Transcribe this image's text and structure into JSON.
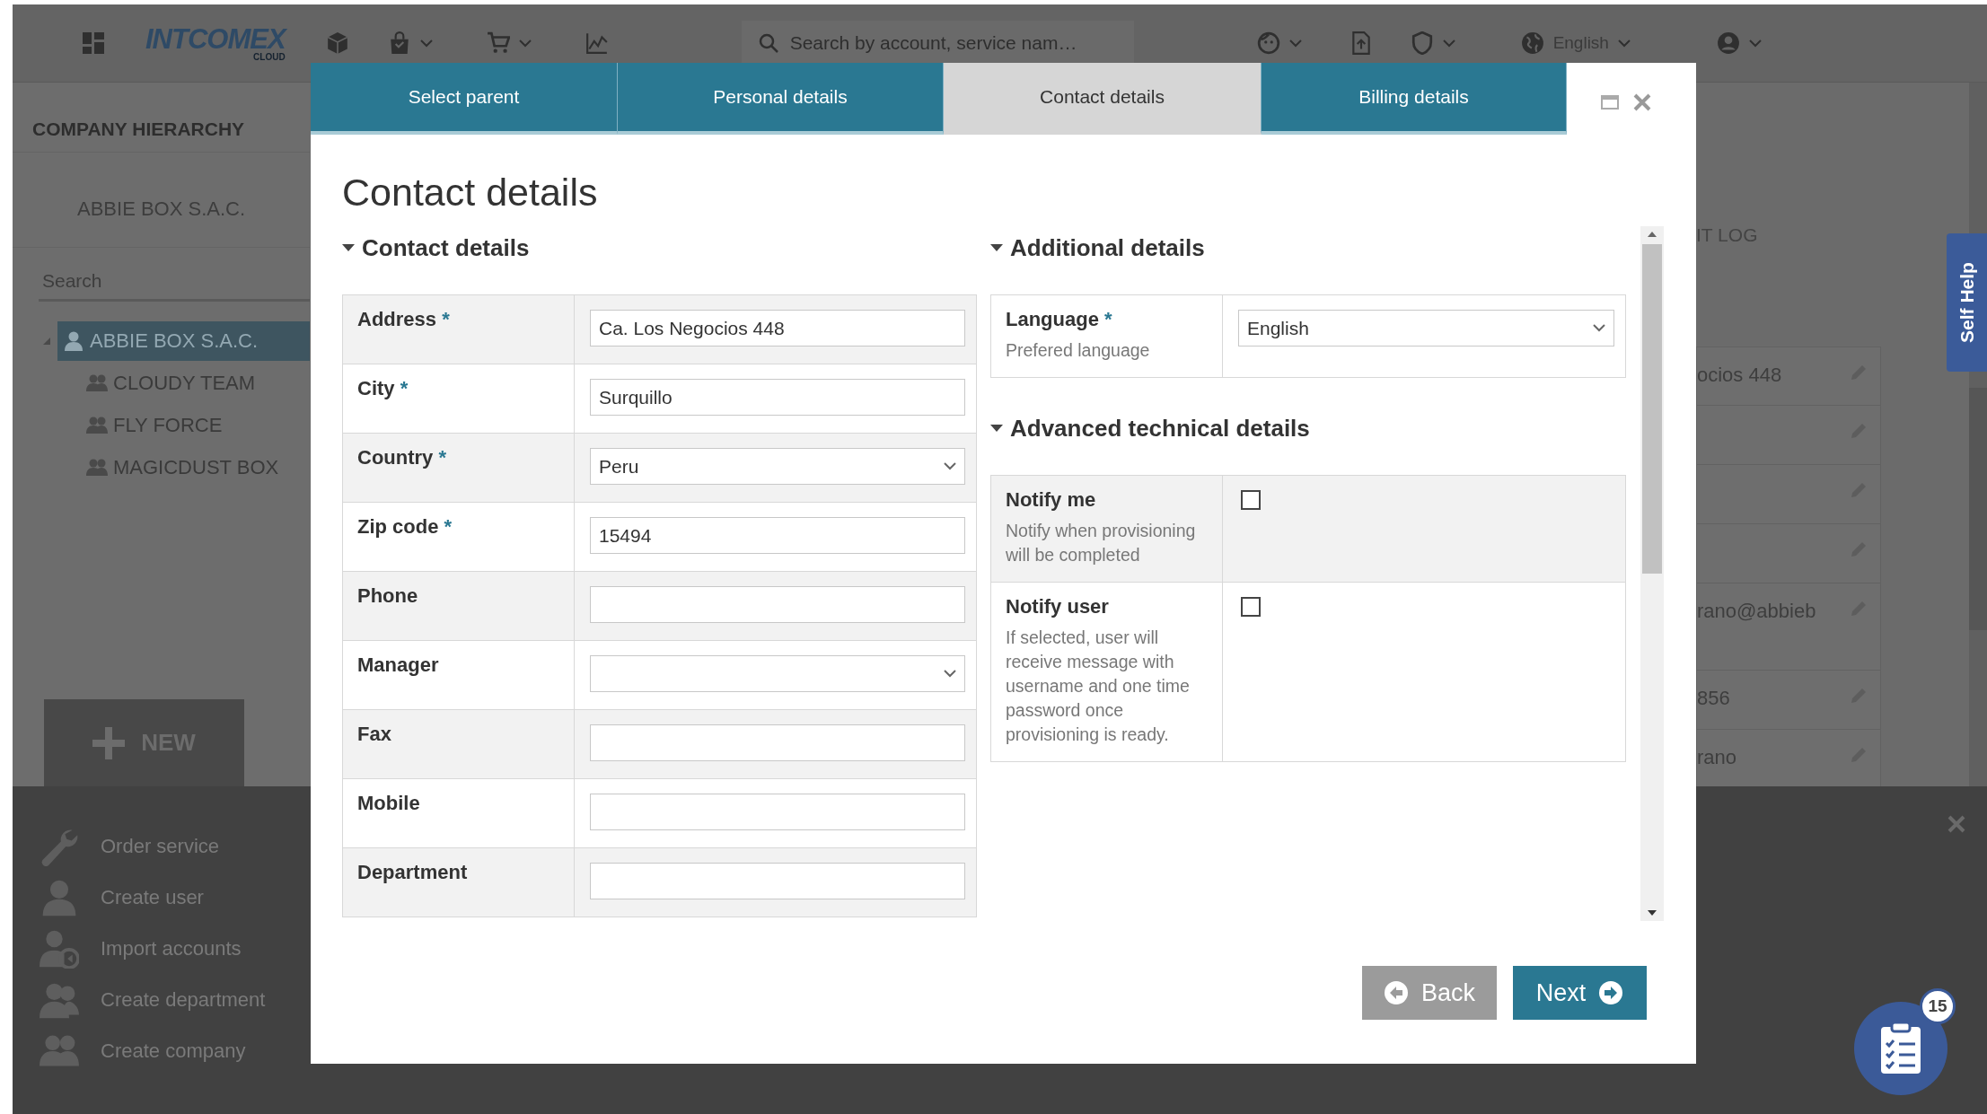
{
  "top_bar": {
    "logo": "INTCOMEX",
    "logo_sub": "CLOUD",
    "search": {
      "placeholder": "Search by account, service nam…"
    },
    "language": "English"
  },
  "sidebar": {
    "title": "COMPANY HIERARCHY",
    "account": "ABBIE BOX S.A.C.",
    "search": {
      "placeholder": "Search"
    },
    "tree": [
      {
        "label": "ABBIE BOX S.A.C.",
        "kind": "user",
        "selected": true,
        "expanded": true,
        "children": [
          {
            "label": "CLOUDY TEAM",
            "kind": "group",
            "selected": false
          },
          {
            "label": "FLY FORCE",
            "kind": "group",
            "selected": false
          },
          {
            "label": "MAGICDUST BOX",
            "kind": "group",
            "selected": false
          }
        ]
      }
    ]
  },
  "background_panel": {
    "heading": "IT LOG",
    "rows": [
      {
        "text": "ocios 448"
      },
      {},
      {},
      {},
      {
        "text": "rano@abbieb"
      },
      {
        "text": "856"
      },
      {
        "text": "rano"
      }
    ]
  },
  "new_menu": {
    "button": "NEW",
    "items": [
      {
        "label": "Order service",
        "kind": "wrench"
      },
      {
        "label": "Create user",
        "kind": "user"
      },
      {
        "label": "Import accounts",
        "kind": "import"
      },
      {
        "label": "Create department",
        "kind": "pair"
      },
      {
        "label": "Create company",
        "kind": "group"
      }
    ]
  },
  "self_help": "Self Help",
  "tasks_button": {
    "count": "15"
  },
  "modal": {
    "tabs": [
      {
        "label": "Select parent",
        "selected": false
      },
      {
        "label": "Personal details",
        "selected": false
      },
      {
        "label": "Contact details",
        "selected": true
      },
      {
        "label": "Billing details",
        "selected": false
      }
    ],
    "title": "Contact details",
    "columns": [
      {
        "sections": [
          {
            "title": "Contact details",
            "expanded": true,
            "fields": [
              {
                "label": "Address",
                "required_mark": "*",
                "kind": "text",
                "value": "Ca. Los Negocios 448"
              },
              {
                "label": "City",
                "required_mark": "*",
                "kind": "text",
                "value": "Surquillo"
              },
              {
                "label": "Country",
                "required_mark": "*",
                "kind": "select",
                "value": "Peru"
              },
              {
                "label": "Zip code",
                "required_mark": "*",
                "kind": "text",
                "value": "15494"
              },
              {
                "label": "Phone",
                "kind": "text"
              },
              {
                "label": "Manager",
                "kind": "select"
              },
              {
                "label": "Fax",
                "kind": "text"
              },
              {
                "label": "Mobile",
                "kind": "text"
              },
              {
                "label": "Department",
                "kind": "text"
              }
            ]
          }
        ]
      },
      {
        "sections": [
          {
            "title": "Additional details",
            "expanded": true,
            "fields": [
              {
                "label": "Language",
                "required_mark": "*",
                "hint": "Prefered language",
                "kind": "select",
                "value": "English"
              }
            ]
          },
          {
            "title": "Advanced technical details",
            "expanded": true,
            "fields": [
              {
                "label": "Notify me",
                "hint": "Notify when provisioning will be completed",
                "kind": "checkbox",
                "checked": false
              },
              {
                "label": "Notify user",
                "hint": "If selected, user will receive message with username and one time password once provisioning is ready.",
                "kind": "checkbox",
                "checked": false
              }
            ]
          }
        ]
      }
    ],
    "buttons": [
      {
        "label": "Back",
        "kind": "back"
      },
      {
        "label": "Next",
        "kind": "next"
      }
    ]
  }
}
